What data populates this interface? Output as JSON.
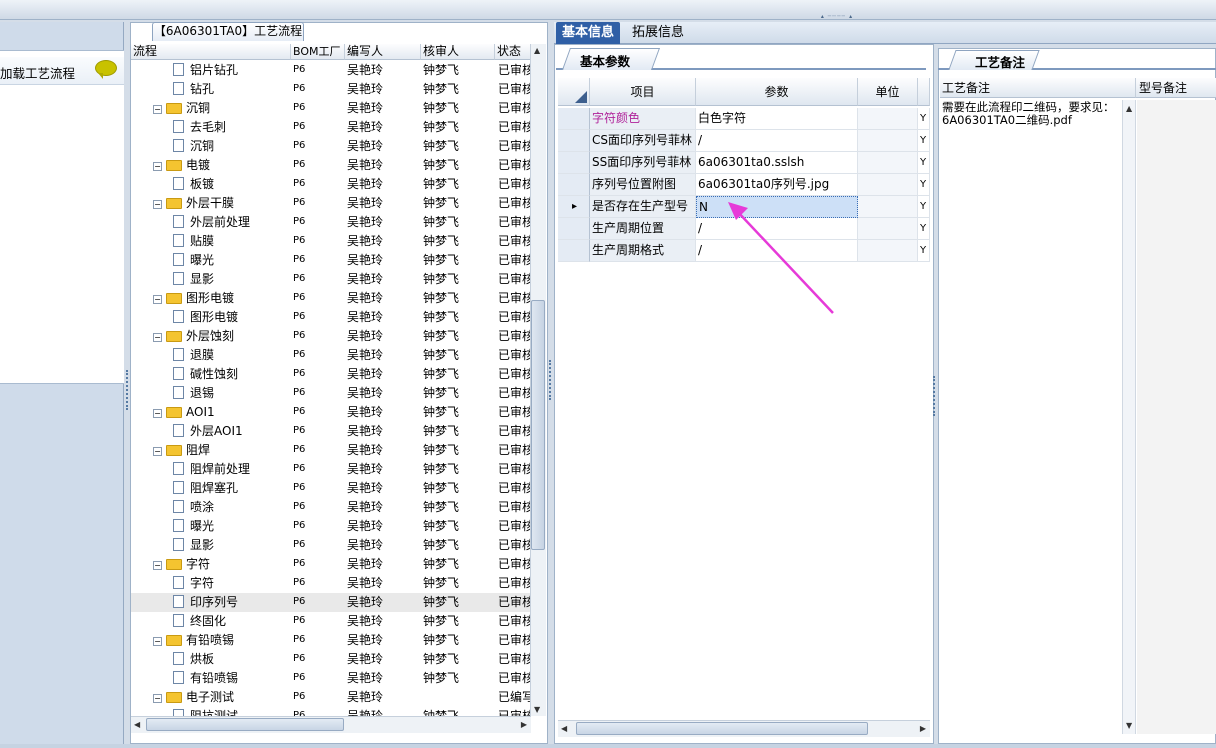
{
  "window": {
    "title": "【6A06301TA0】工艺流程"
  },
  "left_panel": {
    "load_item_label": "加载工艺流程"
  },
  "tree": {
    "columns": [
      "流程",
      "BOM工厂",
      "编写人",
      "核审人",
      "状态"
    ],
    "rows": [
      {
        "label": "铝片钻孔",
        "level": 2,
        "type": "doc",
        "bom": "P6",
        "writer": "吴艳玲",
        "reviewer": "钟梦飞",
        "status": "已审核"
      },
      {
        "label": "钻孔",
        "level": 2,
        "type": "doc",
        "bom": "P6",
        "writer": "吴艳玲",
        "reviewer": "钟梦飞",
        "status": "已审核"
      },
      {
        "label": "沉铜",
        "level": 1,
        "type": "folder",
        "bom": "P6",
        "writer": "吴艳玲",
        "reviewer": "钟梦飞",
        "status": "已审核"
      },
      {
        "label": "去毛刺",
        "level": 2,
        "type": "doc",
        "bom": "P6",
        "writer": "吴艳玲",
        "reviewer": "钟梦飞",
        "status": "已审核"
      },
      {
        "label": "沉铜",
        "level": 2,
        "type": "doc",
        "bom": "P6",
        "writer": "吴艳玲",
        "reviewer": "钟梦飞",
        "status": "已审核"
      },
      {
        "label": "电镀",
        "level": 1,
        "type": "folder",
        "bom": "P6",
        "writer": "吴艳玲",
        "reviewer": "钟梦飞",
        "status": "已审核"
      },
      {
        "label": "板镀",
        "level": 2,
        "type": "doc",
        "bom": "P6",
        "writer": "吴艳玲",
        "reviewer": "钟梦飞",
        "status": "已审核"
      },
      {
        "label": "外层干膜",
        "level": 1,
        "type": "folder",
        "bom": "P6",
        "writer": "吴艳玲",
        "reviewer": "钟梦飞",
        "status": "已审核"
      },
      {
        "label": "外层前处理",
        "level": 2,
        "type": "doc",
        "bom": "P6",
        "writer": "吴艳玲",
        "reviewer": "钟梦飞",
        "status": "已审核"
      },
      {
        "label": "贴膜",
        "level": 2,
        "type": "doc",
        "bom": "P6",
        "writer": "吴艳玲",
        "reviewer": "钟梦飞",
        "status": "已审核"
      },
      {
        "label": "曝光",
        "level": 2,
        "type": "doc",
        "bom": "P6",
        "writer": "吴艳玲",
        "reviewer": "钟梦飞",
        "status": "已审核"
      },
      {
        "label": "显影",
        "level": 2,
        "type": "doc",
        "bom": "P6",
        "writer": "吴艳玲",
        "reviewer": "钟梦飞",
        "status": "已审核"
      },
      {
        "label": "图形电镀",
        "level": 1,
        "type": "folder",
        "bom": "P6",
        "writer": "吴艳玲",
        "reviewer": "钟梦飞",
        "status": "已审核"
      },
      {
        "label": "图形电镀",
        "level": 2,
        "type": "doc",
        "bom": "P6",
        "writer": "吴艳玲",
        "reviewer": "钟梦飞",
        "status": "已审核"
      },
      {
        "label": "外层蚀刻",
        "level": 1,
        "type": "folder",
        "bom": "P6",
        "writer": "吴艳玲",
        "reviewer": "钟梦飞",
        "status": "已审核"
      },
      {
        "label": "退膜",
        "level": 2,
        "type": "doc",
        "bom": "P6",
        "writer": "吴艳玲",
        "reviewer": "钟梦飞",
        "status": "已审核"
      },
      {
        "label": "碱性蚀刻",
        "level": 2,
        "type": "doc",
        "bom": "P6",
        "writer": "吴艳玲",
        "reviewer": "钟梦飞",
        "status": "已审核"
      },
      {
        "label": "退锡",
        "level": 2,
        "type": "doc",
        "bom": "P6",
        "writer": "吴艳玲",
        "reviewer": "钟梦飞",
        "status": "已审核"
      },
      {
        "label": "AOI1",
        "level": 1,
        "type": "folder",
        "bom": "P6",
        "writer": "吴艳玲",
        "reviewer": "钟梦飞",
        "status": "已审核"
      },
      {
        "label": "外层AOI1",
        "level": 2,
        "type": "doc",
        "bom": "P6",
        "writer": "吴艳玲",
        "reviewer": "钟梦飞",
        "status": "已审核"
      },
      {
        "label": "阻焊",
        "level": 1,
        "type": "folder",
        "bom": "P6",
        "writer": "吴艳玲",
        "reviewer": "钟梦飞",
        "status": "已审核"
      },
      {
        "label": "阻焊前处理",
        "level": 2,
        "type": "doc",
        "bom": "P6",
        "writer": "吴艳玲",
        "reviewer": "钟梦飞",
        "status": "已审核"
      },
      {
        "label": "阻焊塞孔",
        "level": 2,
        "type": "doc",
        "bom": "P6",
        "writer": "吴艳玲",
        "reviewer": "钟梦飞",
        "status": "已审核"
      },
      {
        "label": "喷涂",
        "level": 2,
        "type": "doc",
        "bom": "P6",
        "writer": "吴艳玲",
        "reviewer": "钟梦飞",
        "status": "已审核"
      },
      {
        "label": "曝光",
        "level": 2,
        "type": "doc",
        "bom": "P6",
        "writer": "吴艳玲",
        "reviewer": "钟梦飞",
        "status": "已审核"
      },
      {
        "label": "显影",
        "level": 2,
        "type": "doc",
        "bom": "P6",
        "writer": "吴艳玲",
        "reviewer": "钟梦飞",
        "status": "已审核"
      },
      {
        "label": "字符",
        "level": 1,
        "type": "folder",
        "bom": "P6",
        "writer": "吴艳玲",
        "reviewer": "钟梦飞",
        "status": "已审核"
      },
      {
        "label": "字符",
        "level": 2,
        "type": "doc",
        "bom": "P6",
        "writer": "吴艳玲",
        "reviewer": "钟梦飞",
        "status": "已审核"
      },
      {
        "label": "印序列号",
        "level": 2,
        "type": "doc",
        "bom": "P6",
        "writer": "吴艳玲",
        "reviewer": "钟梦飞",
        "status": "已审核",
        "selected": true
      },
      {
        "label": "终固化",
        "level": 2,
        "type": "doc",
        "bom": "P6",
        "writer": "吴艳玲",
        "reviewer": "钟梦飞",
        "status": "已审核"
      },
      {
        "label": "有铅喷锡",
        "level": 1,
        "type": "folder",
        "bom": "P6",
        "writer": "吴艳玲",
        "reviewer": "钟梦飞",
        "status": "已审核"
      },
      {
        "label": "烘板",
        "level": 2,
        "type": "doc",
        "bom": "P6",
        "writer": "吴艳玲",
        "reviewer": "钟梦飞",
        "status": "已审核"
      },
      {
        "label": "有铅喷锡",
        "level": 2,
        "type": "doc",
        "bom": "P6",
        "writer": "吴艳玲",
        "reviewer": "钟梦飞",
        "status": "已审核"
      },
      {
        "label": "电子测试",
        "level": 1,
        "type": "folder",
        "bom": "P6",
        "writer": "吴艳玲",
        "reviewer": "",
        "status": "已编写"
      },
      {
        "label": "阻抗测试",
        "level": 2,
        "type": "doc",
        "bom": "P6",
        "writer": "吴艳玲",
        "reviewer": "钟梦飞",
        "status": "已审核"
      }
    ]
  },
  "tabs": [
    {
      "label": "基本信息",
      "active": true
    },
    {
      "label": "拓展信息",
      "active": false
    }
  ],
  "basic_params": {
    "subtab_label": "基本参数",
    "columns": [
      "项目",
      "参数",
      "单位"
    ],
    "rows": [
      {
        "item": "字符颜色",
        "value": "白色字符",
        "unit": "",
        "flag": "Y",
        "item_color": "#b0239a"
      },
      {
        "item": "CS面印序列号菲林",
        "value": "/",
        "unit": "",
        "flag": "Y"
      },
      {
        "item": "SS面印序列号菲林",
        "value": "6a06301ta0.sslsh",
        "unit": "",
        "flag": "Y"
      },
      {
        "item": "序列号位置附图",
        "value": "6a06301ta0序列号.jpg",
        "unit": "",
        "flag": "Y"
      },
      {
        "item": "是否存在生产型号",
        "value": "N",
        "unit": "",
        "flag": "Y",
        "active": true
      },
      {
        "item": "生产周期位置",
        "value": "/",
        "unit": "",
        "flag": "Y"
      },
      {
        "item": "生产周期格式",
        "value": "/",
        "unit": "",
        "flag": "Y"
      }
    ]
  },
  "process_notes": {
    "subtab_label": "工艺备注",
    "col1": "工艺备注",
    "col2": "型号备注",
    "note_text": "需要在此流程印二维码，要求见：6A06301TA0二维码.pdf"
  },
  "colors": {
    "accent": "#2f5fa6",
    "annotation_arrow": "#e63ad8"
  }
}
